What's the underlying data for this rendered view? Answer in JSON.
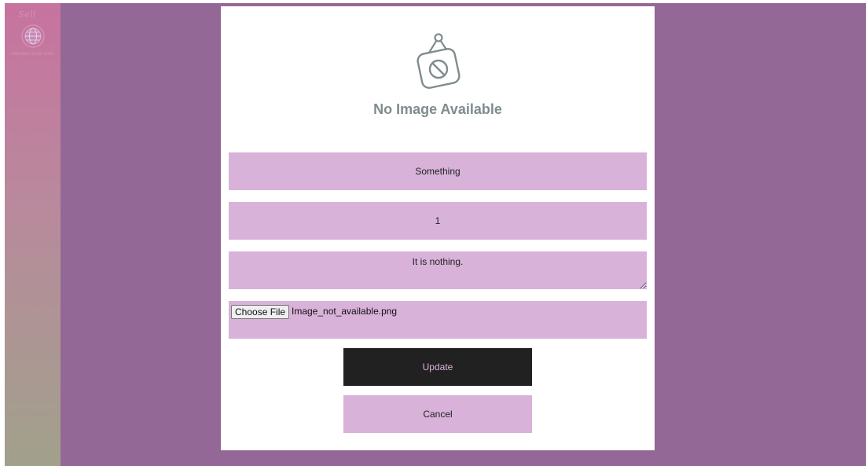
{
  "sidebar": {
    "logo_mark": "Sell",
    "logo_caption": "Republic of the USC",
    "logo_icon": "globe-icon"
  },
  "preview": {
    "icon": "no-image-icon",
    "text": "No Image Available"
  },
  "form": {
    "name_value": "Something",
    "quantity_value": "1",
    "description_value": "It is nothing.",
    "file_button_label": "Choose File",
    "file_name": "Image_not_available.png",
    "update_label": "Update",
    "cancel_label": "Cancel"
  },
  "colors": {
    "background": "#946896",
    "field": "#d8b2d9",
    "update_button": "#212121",
    "no_image_text": "#7f8c8d"
  }
}
